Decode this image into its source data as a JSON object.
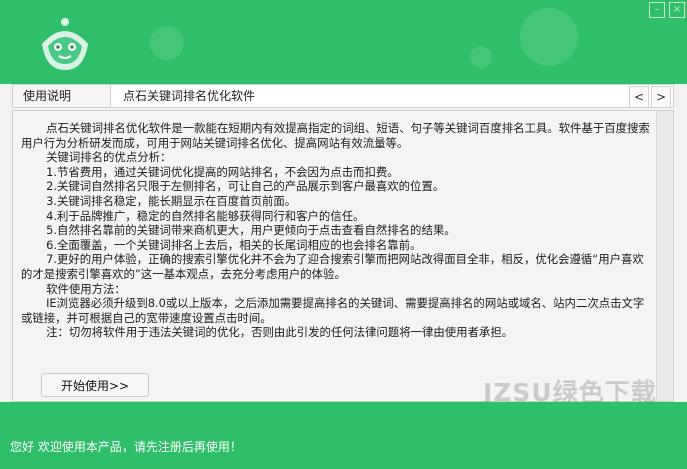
{
  "tabs": [
    {
      "label": "使用说明"
    },
    {
      "label": "点石关键词排名优化软件"
    }
  ],
  "nav": {
    "prev": "<",
    "next": ">"
  },
  "content": {
    "lines": [
      "点石关键词排名优化软件是一款能在短期内有效提高指定的词组、短语、句子等关键词百度排名工具。软件基于百度搜索用户行为分析研发而成，可用于网站关键词排名优化、提高网站有效流量等。",
      "关键词排名的优点分析：",
      "1.节省费用，通过关键词优化提高的网站排名，不会因为点击而扣费。",
      "2.关键词自然排名只限于左侧排名，可让自己的产品展示到客户最喜欢的位置。",
      "3.关键词排名稳定，能长期显示在百度首页前面。",
      "4.利于品牌推广，稳定的自然排名能够获得同行和客户的信任。",
      "5.自然排名靠前的关键词带来商机更大，用户更倾向于点击查看自然排名的结果。",
      "6.全面覆盖，一个关键词排名上去后，相关的长尾词相应的也会排名靠前。",
      "7.更好的用户体验，正确的搜索引擎优化并不会为了迎合搜索引擎而把网站改得面目全非，相反，优化会遵循“用户喜欢的才是搜索引擎喜欢的”这一基本观点，去充分考虑用户的体验。",
      "软件使用方法：",
      "IE浏览器必须升级到8.0或以上版本，之后添加需要提高排名的关键词、需要提高排名的网站或域名、站内二次点击文字或链接，并可根据自己的宽带速度设置点击时间。",
      "注：切勿将软件用于违法关键词的优化，否则由此引发的任何法律问题将一律由使用者承担。"
    ]
  },
  "start_button": "开始使用>>",
  "watermark": "JZSU绿色下载",
  "status_text": "您好 欢迎使用本产品，请先注册后再使用！",
  "colors": {
    "brand_green": "#2fbf6b"
  }
}
